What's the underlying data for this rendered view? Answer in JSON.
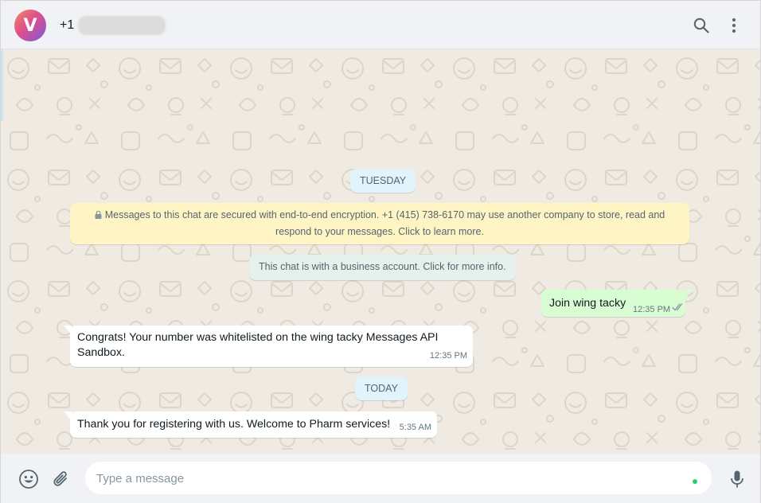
{
  "header": {
    "avatar_letter": "V",
    "contact_prefix": "+1",
    "icons": [
      "search-icon",
      "menu-dots-icon"
    ]
  },
  "chat": {
    "date_tuesday": "TUESDAY",
    "encryption_notice": "Messages to this chat are secured with end-to-end encryption. +1 (415) 738-6170 may use another company to store, read and respond to your messages. Click to learn more.",
    "business_notice": "This chat is with a business account. Click for more info.",
    "messages": [
      {
        "direction": "out",
        "text": "Join wing tacky",
        "time": "12:35 PM",
        "status": "read-double-check"
      },
      {
        "direction": "in",
        "text": "Congrats! Your number was whitelisted on the wing tacky Messages API Sandbox.",
        "time": "12:35 PM"
      },
      {
        "direction": "in",
        "text": "Thank you for registering with us. Welcome to Pharm services!",
        "time": "5:35 AM"
      }
    ],
    "date_today": "TODAY"
  },
  "composer": {
    "placeholder": "Type a message",
    "value": "",
    "icons": [
      "emoji-icon",
      "attach-icon",
      "mic-icon"
    ]
  },
  "colors": {
    "header_bg": "#f0f2f5",
    "chat_bg": "#efeae2",
    "outgoing_bubble": "#d9fdd3",
    "incoming_bubble": "#ffffff",
    "encryption_notice_bg": "#fff5c4",
    "date_pill_bg": "#e1f3fb",
    "read_tick": "#53bdeb"
  }
}
